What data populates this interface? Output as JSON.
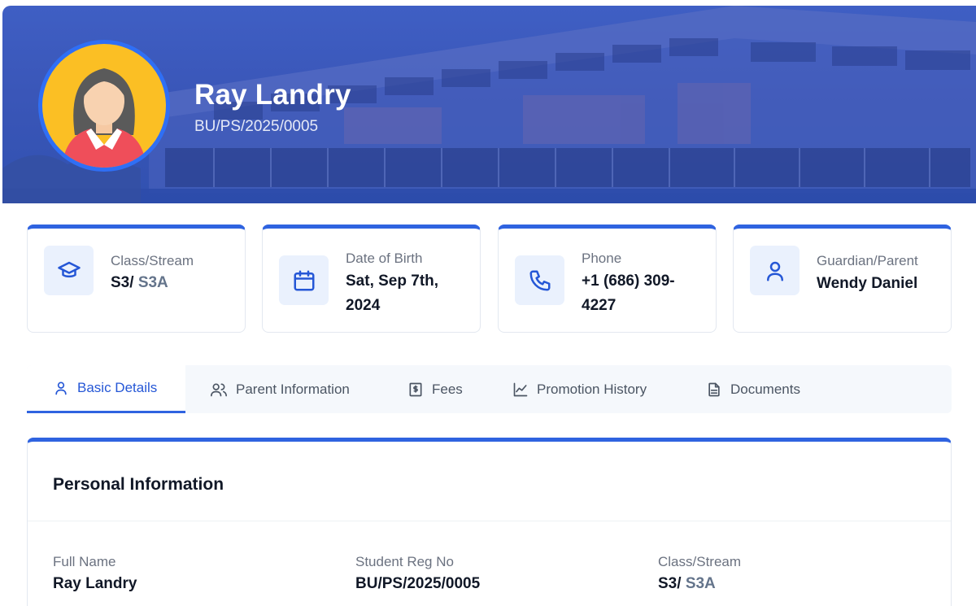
{
  "profile": {
    "name": "Ray Landry",
    "reg_no": "BU/PS/2025/0005"
  },
  "cards": {
    "class": {
      "label": "Class/Stream",
      "class_value": "S3/",
      "stream_value": "S3A",
      "icon": "graduation-cap-icon"
    },
    "dob": {
      "label": "Date of Birth",
      "line1": "Sat, Sep 7th,",
      "line2": "2024",
      "icon": "calendar-icon"
    },
    "phone": {
      "label": "Phone",
      "line1": "+1 (686) 309-",
      "line2": "4227",
      "icon": "phone-icon"
    },
    "guardian": {
      "label": "Guardian/Parent",
      "value": "Wendy Daniel",
      "icon": "user-icon"
    }
  },
  "tabs": [
    {
      "label": "Basic Details",
      "icon": "user-icon",
      "active": true
    },
    {
      "label": "Parent Information",
      "icon": "users-icon",
      "active": false
    },
    {
      "label": "Fees",
      "icon": "receipt-icon",
      "active": false
    },
    {
      "label": "Promotion History",
      "icon": "line-chart-icon",
      "active": false
    },
    {
      "label": "Documents",
      "icon": "document-icon",
      "active": false
    }
  ],
  "personal_info": {
    "title": "Personal Information",
    "fields": {
      "full_name": {
        "label": "Full Name",
        "value": "Ray Landry"
      },
      "reg_no": {
        "label": "Student Reg No",
        "value": "BU/PS/2025/0005"
      },
      "class_stream": {
        "label": "Class/Stream",
        "class_value": "S3/",
        "stream_value": "S3A"
      }
    }
  },
  "colors": {
    "accent": "#2f63e0",
    "banner": "#3a56b8",
    "avatar_bg": "#fbbf24"
  }
}
